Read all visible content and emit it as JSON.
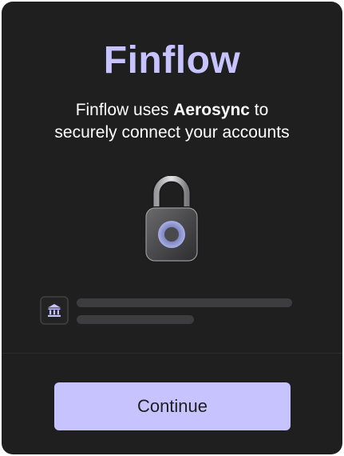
{
  "header": {
    "brand": "Finflow",
    "subtitle_prefix": "Finflow uses ",
    "subtitle_strong": "Aerosync",
    "subtitle_suffix": " to",
    "subtitle_line2": "securely connect your accounts"
  },
  "graphic": {
    "icon": "padlock-icon"
  },
  "bank_row": {
    "icon": "bank-icon"
  },
  "footer": {
    "continue_label": "Continue"
  },
  "colors": {
    "background": "#1f1f20",
    "accent": "#c7c3ff",
    "text": "#ffffff",
    "skeleton": "#3d3d3f"
  }
}
